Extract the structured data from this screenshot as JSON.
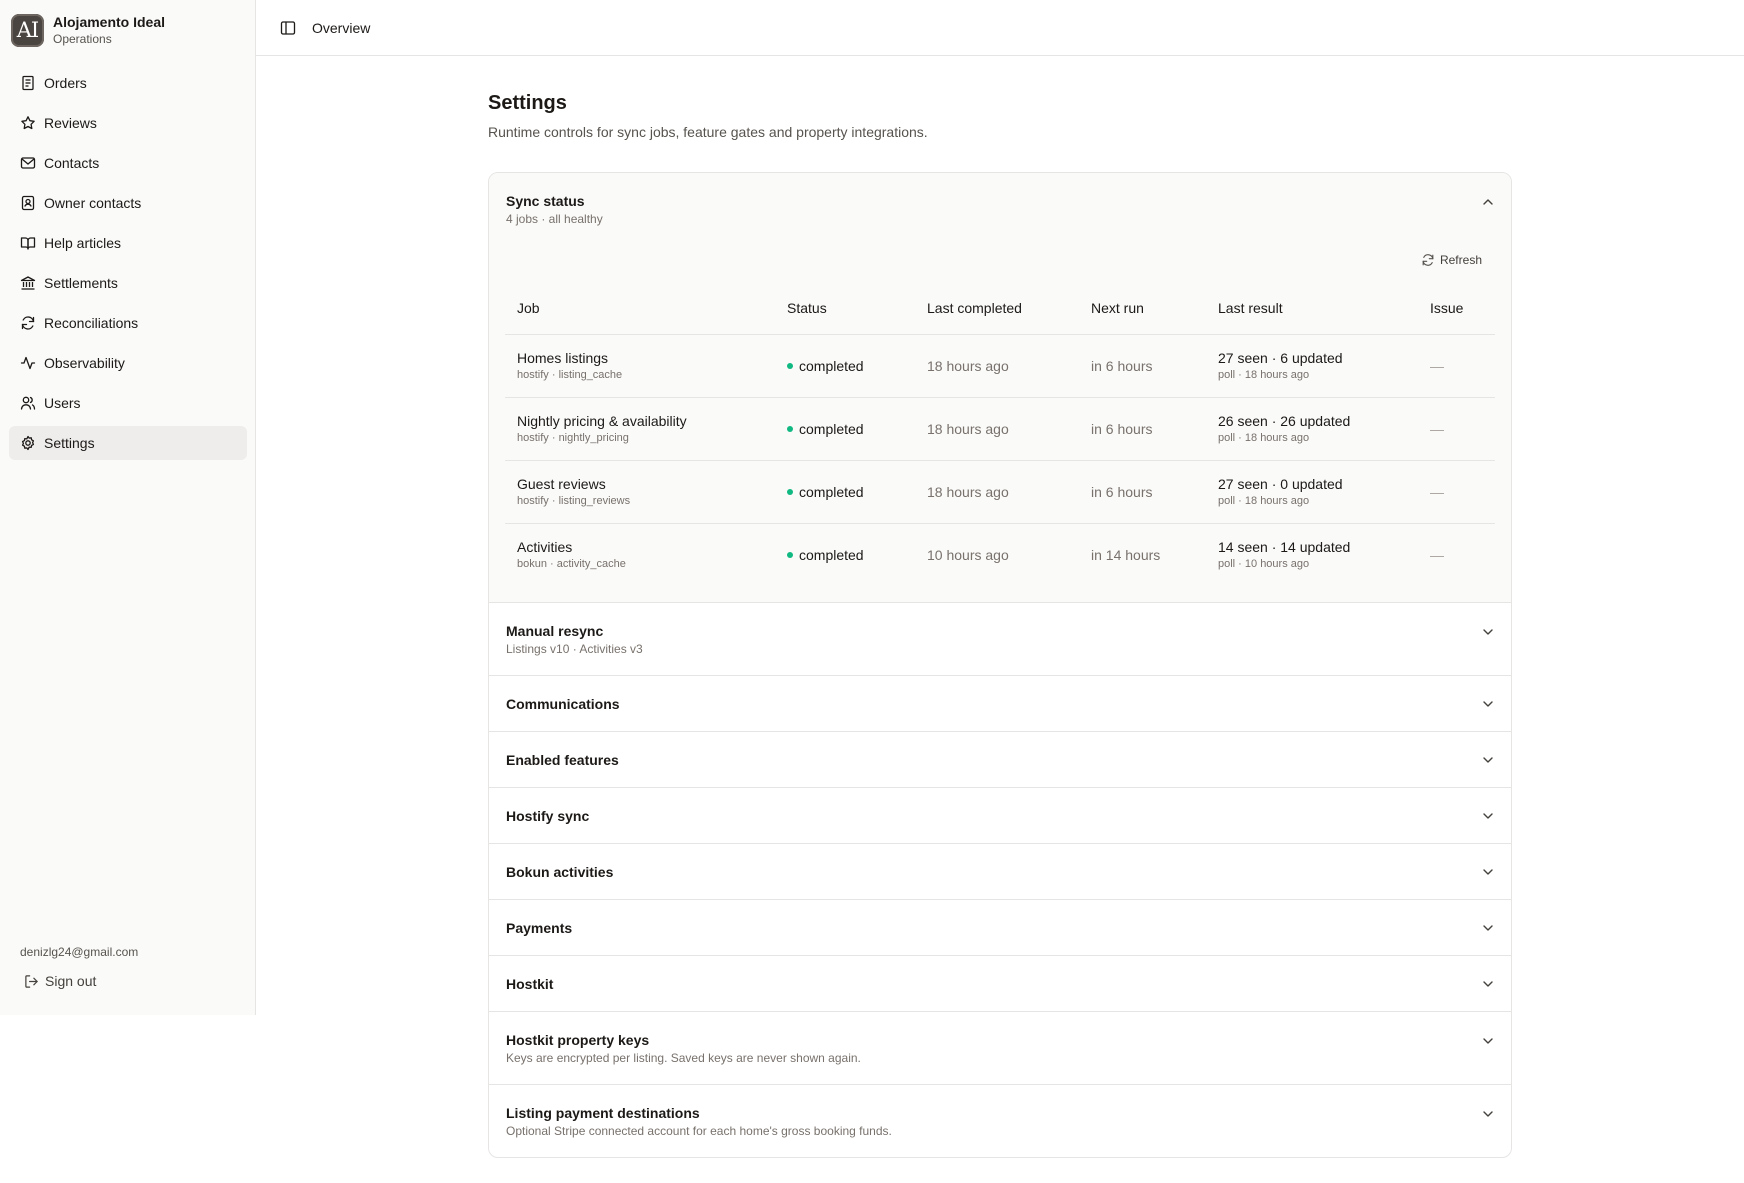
{
  "brand": {
    "logo": "AI",
    "name": "Alojamento Ideal",
    "sub": "Operations"
  },
  "nav": [
    {
      "label": "Orders",
      "icon": "receipt-icon"
    },
    {
      "label": "Reviews",
      "icon": "star-icon"
    },
    {
      "label": "Contacts",
      "icon": "mail-icon"
    },
    {
      "label": "Owner contacts",
      "icon": "contact-book-icon"
    },
    {
      "label": "Help articles",
      "icon": "book-open-icon"
    },
    {
      "label": "Settlements",
      "icon": "bank-icon"
    },
    {
      "label": "Reconciliations",
      "icon": "refresh-icon"
    },
    {
      "label": "Observability",
      "icon": "activity-icon"
    },
    {
      "label": "Users",
      "icon": "users-icon"
    },
    {
      "label": "Settings",
      "icon": "gear-icon",
      "active": true
    }
  ],
  "footer": {
    "email": "denizlg24@gmail.com",
    "signout": "Sign out"
  },
  "header": {
    "breadcrumb": "Overview"
  },
  "page": {
    "title": "Settings",
    "subtitle": "Runtime controls for sync jobs, feature gates and property integrations."
  },
  "sync": {
    "title": "Sync status",
    "sub": "4 jobs · all healthy",
    "refresh": "Refresh",
    "columns": [
      "Job",
      "Status",
      "Last completed",
      "Next run",
      "Last result",
      "Issue"
    ],
    "rows": [
      {
        "name": "Homes listings",
        "src": "hostify · listing_cache",
        "status": "completed",
        "last": "18 hours ago",
        "next": "in 6 hours",
        "result": "27 seen · 6 updated",
        "result_sub": "poll · 18 hours ago",
        "issue": "—"
      },
      {
        "name": "Nightly pricing & availability",
        "src": "hostify · nightly_pricing",
        "status": "completed",
        "last": "18 hours ago",
        "next": "in 6 hours",
        "result": "26 seen · 26 updated",
        "result_sub": "poll · 18 hours ago",
        "issue": "—"
      },
      {
        "name": "Guest reviews",
        "src": "hostify · listing_reviews",
        "status": "completed",
        "last": "18 hours ago",
        "next": "in 6 hours",
        "result": "27 seen · 0 updated",
        "result_sub": "poll · 18 hours ago",
        "issue": "—"
      },
      {
        "name": "Activities",
        "src": "bokun · activity_cache",
        "status": "completed",
        "last": "10 hours ago",
        "next": "in 14 hours",
        "result": "14 seen · 14 updated",
        "result_sub": "poll · 10 hours ago",
        "issue": "—"
      }
    ]
  },
  "sections": [
    {
      "title": "Manual resync",
      "sub": "Listings v10 · Activities v3"
    },
    {
      "title": "Communications",
      "sub": ""
    },
    {
      "title": "Enabled features",
      "sub": ""
    },
    {
      "title": "Hostify sync",
      "sub": ""
    },
    {
      "title": "Bokun activities",
      "sub": ""
    },
    {
      "title": "Payments",
      "sub": ""
    },
    {
      "title": "Hostkit",
      "sub": ""
    },
    {
      "title": "Hostkit property keys",
      "sub": "Keys are encrypted per listing. Saved keys are never shown again."
    },
    {
      "title": "Listing payment destinations",
      "sub": "Optional Stripe connected account for each home's gross booking funds."
    }
  ],
  "colors": {
    "status_ok": "#10b981",
    "sidebar_bg": "#fafaf9",
    "active_bg": "#efedeb"
  }
}
